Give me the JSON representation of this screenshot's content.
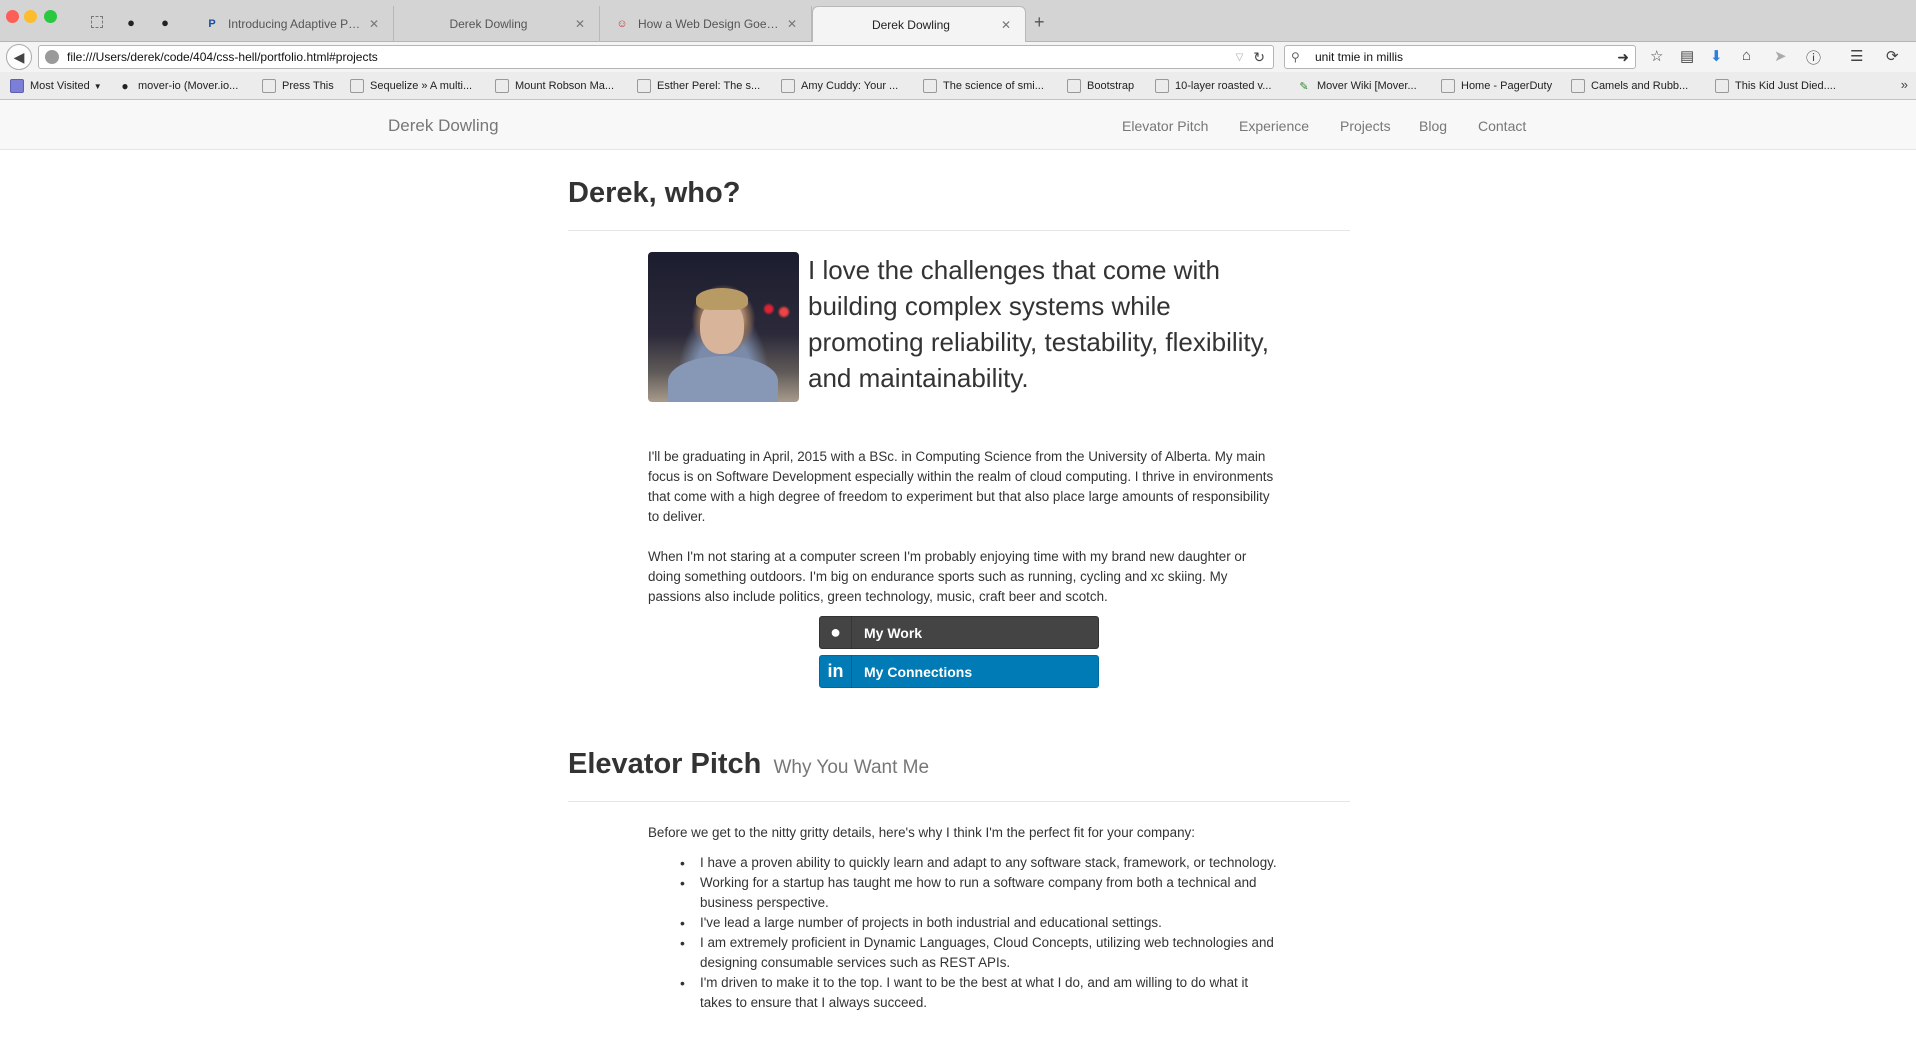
{
  "browser": {
    "tabs": [
      {
        "title": "Introducing Adaptive Paym...",
        "favicon": "P"
      },
      {
        "title": "Derek Dowling",
        "favicon": ""
      },
      {
        "title": "How a Web Design Goes St...",
        "favicon": "☺"
      },
      {
        "title": "Derek Dowling",
        "favicon": "",
        "active": true
      }
    ],
    "url": "file:///Users/derek/code/404/css-hell/portfolio.html#projects",
    "search_value": "unit tmie in millis",
    "bookmarks": [
      {
        "label": "Most Visited",
        "icon": "folder-icon"
      },
      {
        "label": "mover-io (Mover.io...",
        "icon": "github-icon"
      },
      {
        "label": "Press This",
        "icon": "page-icon"
      },
      {
        "label": "Sequelize » A multi...",
        "icon": "page-icon"
      },
      {
        "label": "Mount Robson Ma...",
        "icon": "page-icon"
      },
      {
        "label": "Esther Perel: The s...",
        "icon": "page-icon"
      },
      {
        "label": "Amy Cuddy: Your ...",
        "icon": "page-icon"
      },
      {
        "label": "The science of smi...",
        "icon": "page-icon"
      },
      {
        "label": "Bootstrap",
        "icon": "page-icon"
      },
      {
        "label": "10-layer roasted v...",
        "icon": "page-icon"
      },
      {
        "label": "Mover Wiki [Mover...",
        "icon": "wiki-icon"
      },
      {
        "label": "Home - PagerDuty",
        "icon": "page-icon"
      },
      {
        "label": "Camels and Rubb...",
        "icon": "page-icon"
      },
      {
        "label": "This Kid Just Died....",
        "icon": "page-icon"
      }
    ]
  },
  "site": {
    "brand": "Derek Dowling",
    "nav": [
      "Elevator Pitch",
      "Experience",
      "Projects",
      "Blog",
      "Contact"
    ]
  },
  "about": {
    "title": "Derek, who?",
    "quote": "I love the challenges that come with building complex systems while promoting reliability, testability, flexibility, and maintainability.",
    "para1": "I'll be graduating in April, 2015 with a BSc. in Computing Science from the University of Alberta. My main focus is on Software Development especially within the realm of cloud computing. I thrive in environments that come with a high degree of freedom to experiment but that also place large amounts of responsibility to deliver.",
    "para2": "When I'm not staring at a computer screen I'm probably enjoying time with my brand new daughter or doing something outdoors. I'm big on endurance sports such as running, cycling and xc skiing. My passions also include politics, green technology, music, craft beer and scotch.",
    "buttons": {
      "work": "My Work",
      "connections": "My Connections"
    }
  },
  "elevator": {
    "title": "Elevator Pitch",
    "subtitle": "Why You Want Me",
    "intro": "Before we get to the nitty gritty details, here's why I think I'm the perfect fit for your company:",
    "points": [
      "I have a proven ability to quickly learn and adapt to any software stack, framework, or technology.",
      "Working for a startup has taught me how to run a software company from both a technical and business perspective.",
      "I've lead a large number of projects in both industrial and educational settings.",
      "I am extremely proficient in Dynamic Languages, Cloud Concepts, utilizing web technologies and designing consumable services such as REST APIs.",
      "I'm driven to make it to the top. I want to be the best at what I do, and am willing to do what it takes to ensure that I always succeed."
    ]
  },
  "colors": {
    "github_button": "#444444",
    "linkedin_button": "#007bb6",
    "traffic_close": "#fc5f57",
    "traffic_min": "#fdbc2e",
    "traffic_max": "#28c840"
  }
}
